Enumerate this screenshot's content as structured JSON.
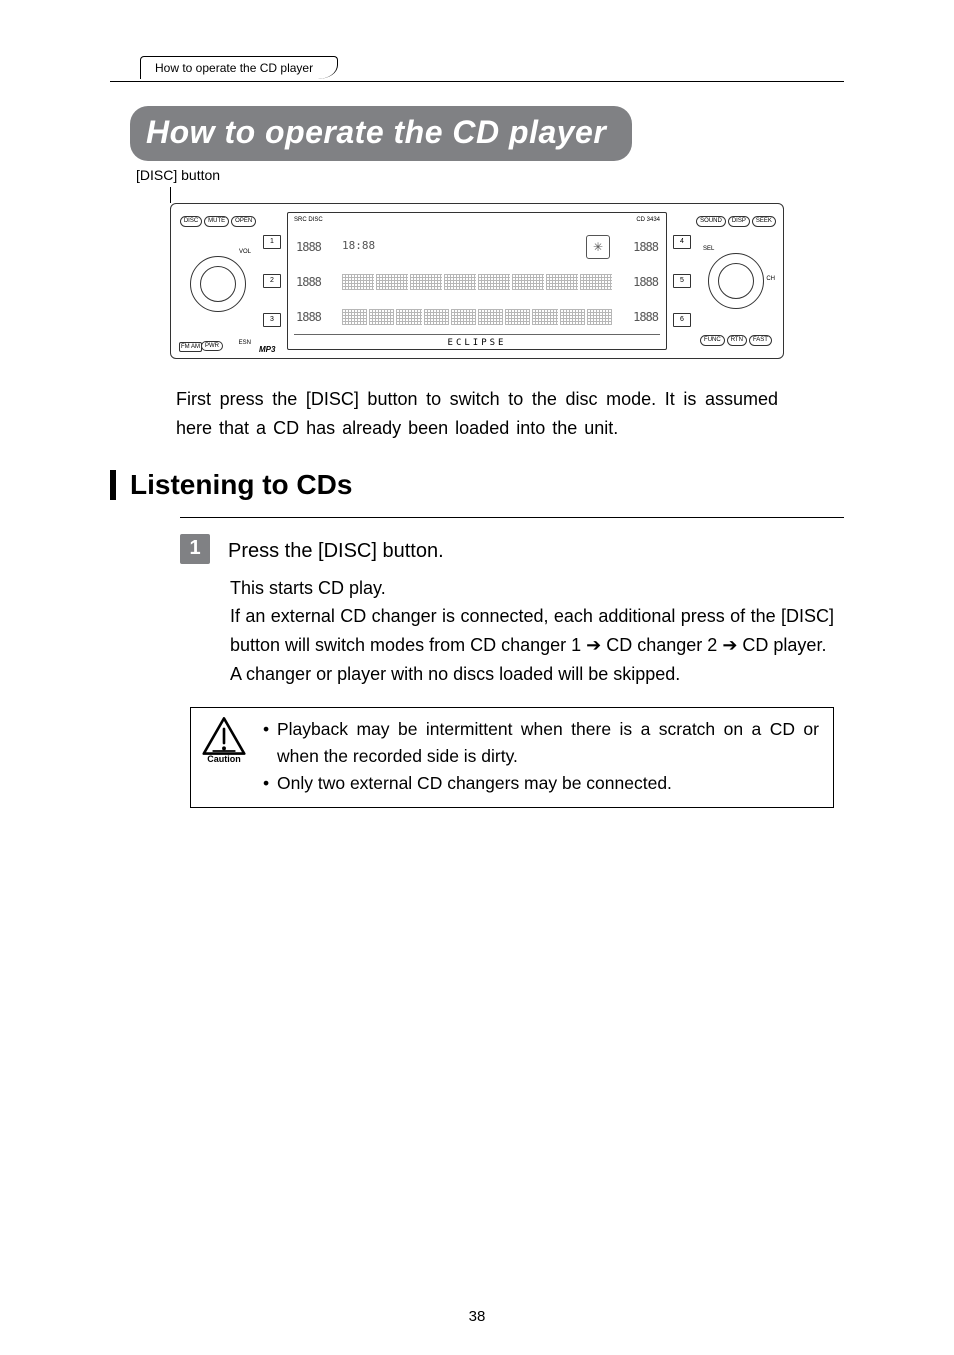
{
  "tab_label": "How to operate the CD player",
  "title": "How to operate the CD player",
  "callout_label": "[DISC] button",
  "device": {
    "top_left_pills": [
      "DISC",
      "MUTE",
      "OPEN"
    ],
    "top_right_pills": [
      "SOUND",
      "DISP",
      "SEEK"
    ],
    "bottom_right_pills": [
      "FUNC",
      "RTN",
      "FAST"
    ],
    "vol_label": "VOL",
    "esn_label": "ESN",
    "sel_label": "SEL",
    "ch_label": "CH",
    "fmam_label": "FM\nAM",
    "pwr_label": "PWR",
    "mp3_label": "MP3",
    "model_label": "CD 3434",
    "left_nums": [
      "1",
      "2",
      "3"
    ],
    "right_nums": [
      "4",
      "5",
      "6"
    ],
    "seg_placeholder": "1888",
    "display_small_labels": "SRC  DISC",
    "display_time": "18:88",
    "brand": "ECLIPSE"
  },
  "intro_text": "First press the [DISC] button to switch to the disc mode.  It is assumed here that a CD has already been loaded into the unit.",
  "section_heading": "Listening to CDs",
  "step": {
    "number": "1",
    "title": "Press the [DISC] button.",
    "body_line1": "This starts CD play.",
    "body_line2_a": "If an external CD changer is connected, each additional press of the [DISC] button will switch modes from CD changer 1 ",
    "body_line2_b": " CD changer 2 ",
    "body_line2_c": " CD player.",
    "body_line3": "A changer or player with no discs loaded will be skipped."
  },
  "arrow": "➔",
  "caution": {
    "label": "Caution",
    "items": [
      "Playback may be intermittent when there is a scratch on a CD or when the recorded side is dirty.",
      "Only two external CD changers may be connected."
    ]
  },
  "page_number": "38"
}
